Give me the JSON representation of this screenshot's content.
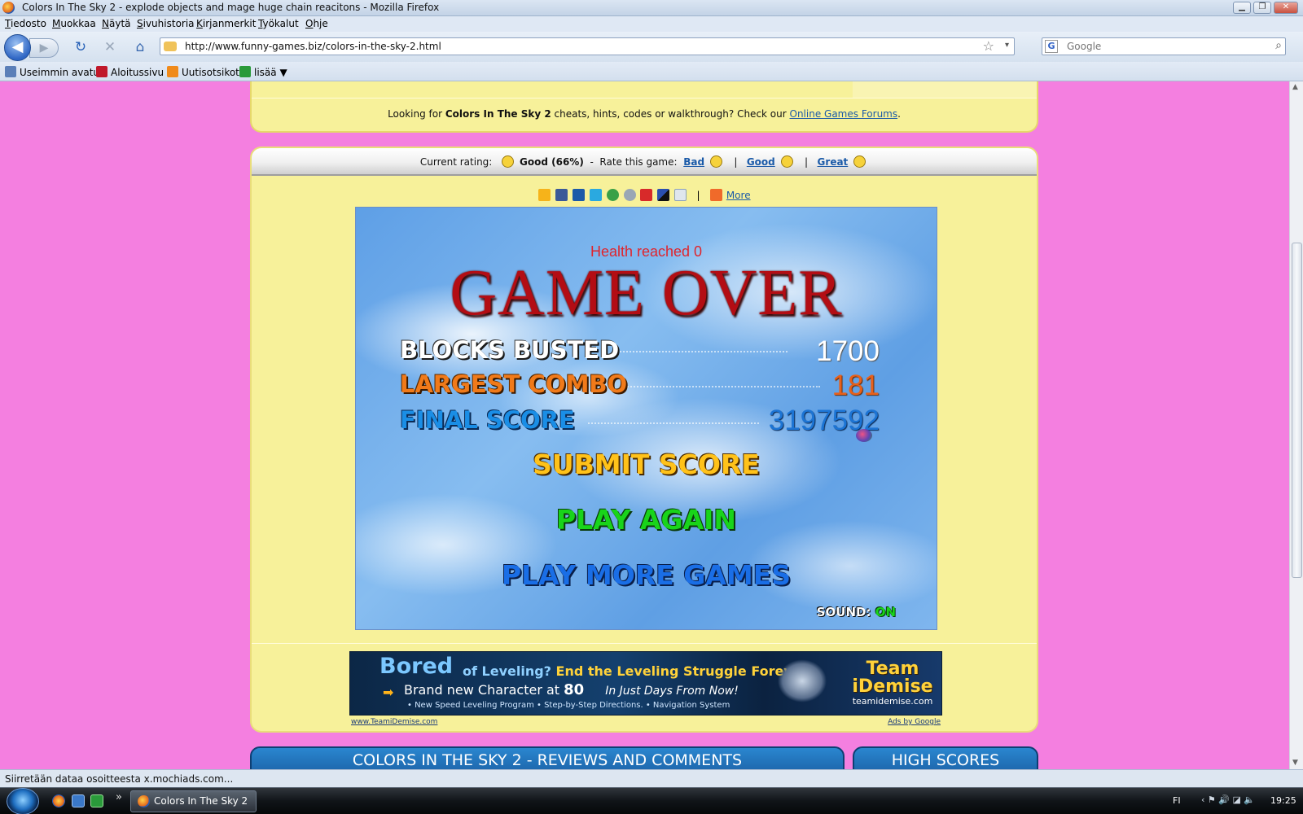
{
  "window": {
    "title": "Colors In The Sky 2 - explode objects and mage huge chain reacitons - Mozilla Firefox",
    "minimize": "▁",
    "restore": "❐",
    "close": "✕"
  },
  "menu": [
    "Tiedosto",
    "Muokkaa",
    "Näytä",
    "Sivuhistoria",
    "Kirjanmerkit",
    "Työkalut",
    "Ohje"
  ],
  "nav": {
    "back_glyph": "◀",
    "forward_glyph": "▶",
    "reload_glyph": "↻",
    "stop_glyph": "✕",
    "home_glyph": "⌂",
    "url": "http://www.funny-games.biz/colors-in-the-sky-2.html",
    "star_glyph": "☆",
    "dropdown_glyph": "▾",
    "search_engine": "G",
    "search_placeholder": "Google",
    "search_glyph": "⌕"
  },
  "bookmarks": [
    {
      "label": "Useimmin avatut",
      "icon": "page-icon",
      "color": "#5a7fb8"
    },
    {
      "label": "Aloitussivu",
      "icon": "cow-icon",
      "color": "#c0182a"
    },
    {
      "label": "Uutisotsikot",
      "icon": "rss-icon",
      "color": "#f08a1a"
    },
    {
      "label": "lisää ▼",
      "icon": "puzzle-icon",
      "color": "#2a9a3a"
    }
  ],
  "page": {
    "forum_prefix": "Looking for ",
    "forum_game": "Colors In The Sky 2",
    "forum_middle": " cheats, hints, codes or walkthrough? Check our ",
    "forum_link": "Online Games Forums",
    "forum_suffix": ".",
    "rating": {
      "current_label": "Current rating:",
      "current_value": "Good (66%)",
      "dash": "-",
      "rate_label": "Rate this game:",
      "bad": "Bad",
      "good": "Good",
      "great": "Great",
      "sep": "|"
    },
    "share": {
      "more": "More",
      "sep": "|",
      "icons": [
        {
          "name": "favorite-icon",
          "color": "#f6b31a"
        },
        {
          "name": "facebook-icon",
          "color": "#3b5998"
        },
        {
          "name": "myspace-icon",
          "color": "#1c5aa8"
        },
        {
          "name": "twitter-icon",
          "color": "#2aa9e0"
        },
        {
          "name": "stumbleupon-icon",
          "color": "#3aa047"
        },
        {
          "name": "reddit-icon",
          "color": "#9aa7b5"
        },
        {
          "name": "mixx-icon",
          "color": "#d82a2a"
        },
        {
          "name": "delicious-icon",
          "color": "#2a4fb0"
        },
        {
          "name": "email-icon",
          "color": "#8aa0b8"
        }
      ],
      "more_icon_color": "#f06a2a"
    }
  },
  "game": {
    "health_msg": "Health reached 0",
    "title": "GAME OVER",
    "stats": [
      {
        "label": "BLOCKS BUSTED",
        "value": "1700"
      },
      {
        "label": "LARGEST COMBO",
        "value": "181"
      },
      {
        "label": "FINAL SCORE",
        "value": "3197592"
      }
    ],
    "buttons": {
      "submit": "SUBMIT SCORE",
      "again": "PLAY AGAIN",
      "more": "PLAY MORE GAMES"
    },
    "sound_label": "SOUND:",
    "sound_value": "ON"
  },
  "ad": {
    "bored": "Bored",
    "of": "of Leveling?",
    "headline": "End the Leveling Struggle Forever!",
    "arrow": "➡",
    "line2_a": "Brand new Character at ",
    "line2_b": "80",
    "line2_c": "In Just Days From Now!",
    "features": "• New  Speed  Leveling Program     • Step-by-Step Directions.     • Navigation System",
    "brand_top": "Team",
    "brand_bottom": "iDemise",
    "brand_domain": "teamidemise.com",
    "foot_left": "www.TeamiDemise.com",
    "foot_right": "Ads by Google"
  },
  "tabs": {
    "reviews": "COLORS IN THE SKY 2 - REVIEWS AND COMMENTS",
    "scores": "HIGH SCORES"
  },
  "status": "Siirretään dataa osoitteesta x.mochiads.com...",
  "taskbar": {
    "task_label": "Colors In The Sky 2 ...",
    "more": "»",
    "lang": "FI",
    "tray": "‹  ⚑  🔊  ◪  🔈",
    "clock": "19:25"
  }
}
